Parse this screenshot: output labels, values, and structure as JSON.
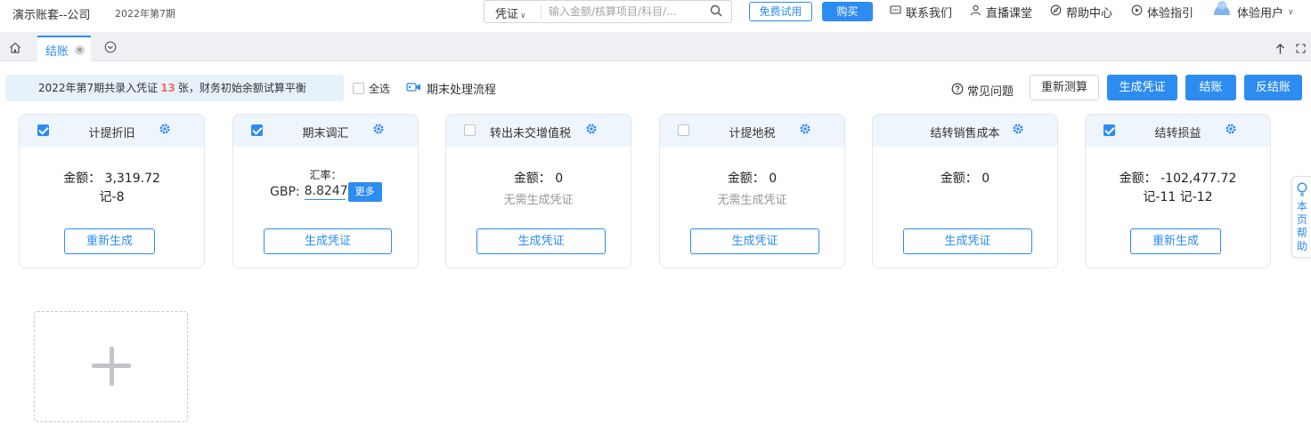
{
  "header": {
    "company": "演示账套--公司",
    "period": "2022年第7期",
    "search": {
      "type": "凭证",
      "placeholder": "输入金额/核算项目/科目/..."
    },
    "trial_button": "免费试用",
    "buy_button": "购买",
    "links": [
      {
        "label": "联系我们",
        "icon": "chat-icon"
      },
      {
        "label": "直播课堂",
        "icon": "person-icon"
      },
      {
        "label": "帮助中心",
        "icon": "compass-icon"
      },
      {
        "label": "体验指引",
        "icon": "play-icon"
      }
    ],
    "user": "体验用户"
  },
  "tabs": {
    "active": "结账"
  },
  "toolbar": {
    "notice_prefix": "2022年第7期共录入凭证",
    "notice_count": "13",
    "notice_suffix": "张，财务初始余额试算平衡",
    "select_all": "全选",
    "flow_link": "期末处理流程",
    "faq": "常见问题",
    "remeasure_button": "重新测算",
    "generate_button": "生成凭证",
    "close_button": "结账",
    "unclose_button": "反结账"
  },
  "cards": [
    {
      "title": "计提折旧",
      "checked": true,
      "amount_label": "金额：",
      "amount": "3,319.72",
      "sub": "记-8",
      "action": "重新生成"
    },
    {
      "title": "期末调汇",
      "checked": true,
      "rate_label": "汇率：",
      "currency": "GBP:",
      "rate": "8.8247",
      "more": "更多",
      "action": "生成凭证"
    },
    {
      "title": "转出未交增值税",
      "checked": false,
      "amount_label": "金额：",
      "amount": "0",
      "sub": "无需生成凭证",
      "action": "生成凭证"
    },
    {
      "title": "计提地税",
      "checked": false,
      "amount_label": "金额：",
      "amount": "0",
      "sub": "无需生成凭证",
      "action": "生成凭证"
    },
    {
      "title": "结转销售成本",
      "amount_label": "金额：",
      "amount": "0",
      "action": "生成凭证"
    },
    {
      "title": "结转损益",
      "checked": true,
      "amount_label": "金额：",
      "amount": "-102,477.72",
      "sub": "记-11 记-12",
      "action": "重新生成"
    }
  ],
  "help_tab": "本页帮助",
  "colors": {
    "accent": "#2d8cf0",
    "notice_bg": "#e6f1fc",
    "card_header_bg": "#eef5fd",
    "count_red": "#f56c6c"
  }
}
